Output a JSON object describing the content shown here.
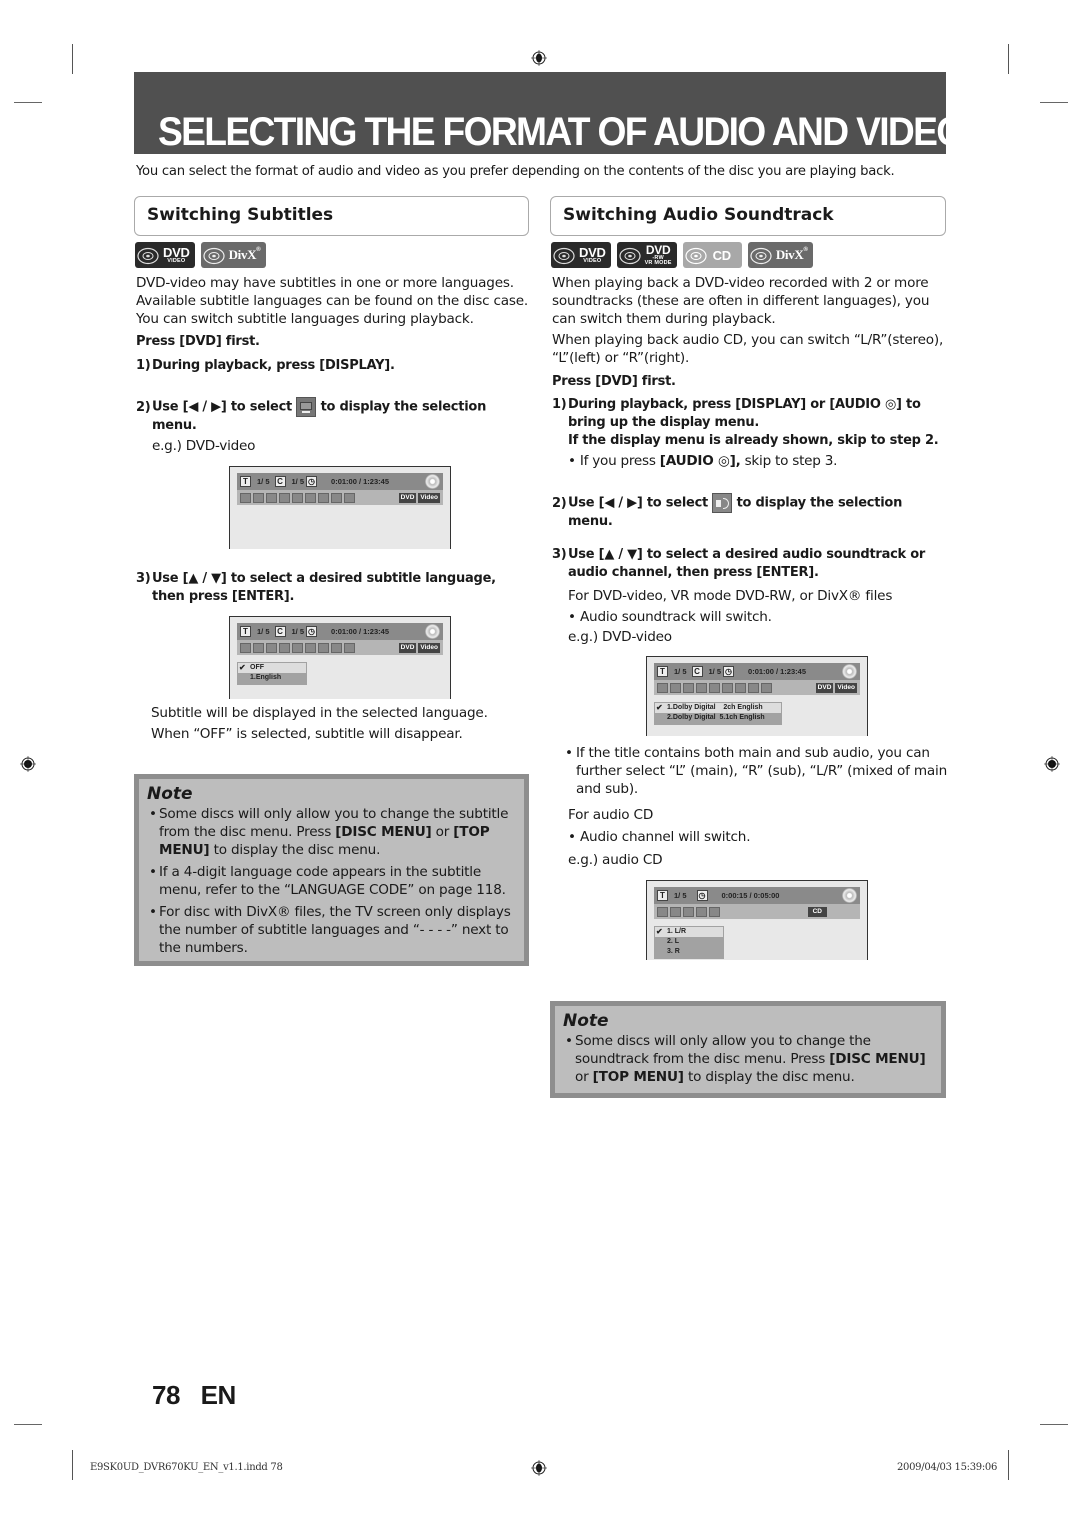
{
  "page": {
    "title": "SELECTING THE FORMAT OF AUDIO AND VIDEO",
    "intro": "You can select the format of audio and video as you prefer depending on the contents of the disc you are playing back.",
    "page_number": "78",
    "language": "EN",
    "footer_file": "E9SK0UD_DVR670KU_EN_v1.1.indd  78",
    "footer_timestamp": "2009/04/03   15:39:06"
  },
  "badges": {
    "dvd_video": {
      "main": "DVD",
      "sub": "VIDEO"
    },
    "dvd_rw_vr": {
      "main": "DVD",
      "sub1": "-RW",
      "sub2": "VR MODE"
    },
    "cd": {
      "main": "CD"
    },
    "divx": {
      "main": "DivX",
      "reg": "®"
    }
  },
  "subtitles": {
    "heading": "Switching Subtitles",
    "description": "DVD-video may have subtitles in one or more languages. Available subtitle languages can be found on the disc case. You can switch subtitle languages during playback.",
    "press_first": "Press [DVD] first.",
    "step1_num": "1)",
    "step1": "During playback, press [DISPLAY].",
    "step2_num": "2)",
    "step2_a": "Use [◀ / ▶] to select",
    "step2_b": "to display the selection",
    "step2_c": "menu.",
    "example1": "e.g.) DVD-video",
    "step3_num": "3)",
    "step3_a": "Use [▲ / ▼] to select a desired subtitle language,",
    "step3_b": "then press [ENTER].",
    "result1": "Subtitle will be displayed in the selected language.",
    "result2": "When “OFF” is selected, subtitle will disappear.",
    "osd_list": [
      "OFF",
      "1.English"
    ]
  },
  "osd_dvd": {
    "title_icon": "T",
    "title_val": "1/  5",
    "chapter_icon": "C",
    "chapter_val": "1/  5",
    "time": "0:01:00 / 1:23:45",
    "tag1": "DVD",
    "tag2": "Video"
  },
  "osd_cd": {
    "title_icon": "T",
    "title_val": "1/  5",
    "time": "0:00:15 / 0:05:00",
    "tag1": "CD"
  },
  "subtitles_note": {
    "title": "Note",
    "items": [
      {
        "a": "Some discs will only allow you to change the subtitle from the disc menu. Press ",
        "b": "[DISC MENU]",
        "c": " or ",
        "d": "[TOP MENU]",
        "e": " to display the disc menu."
      },
      {
        "text": "If a 4-digit language code appears in the subtitle menu, refer to the “LANGUAGE CODE” on page 118."
      },
      {
        "text": "For disc with DivX® files, the TV screen only displays the number of subtitle languages and “- - - -” next to the numbers."
      }
    ]
  },
  "audio": {
    "heading": "Switching Audio Soundtrack",
    "description1": "When playing back a DVD-video recorded with 2 or more soundtracks (these are often in different languages), you can switch them during playback.",
    "description2": "When playing back audio CD, you can switch “L/R”(stereo), “L”(left) or “R”(right).",
    "press_first": "Press [DVD] first.",
    "step1_num": "1)",
    "step1_a": "During playback, press [DISPLAY] or [AUDIO ◎] to bring up the display menu.",
    "step1_b": "If the display menu is already shown, skip to step 2.",
    "step1_bullet_a": "If you press ",
    "step1_bullet_b": "[AUDIO ◎],",
    "step1_bullet_c": " skip to step 3.",
    "step2_num": "2)",
    "step2_a": "Use [◀ / ▶] to select",
    "step2_b": "to display the selection",
    "step2_c": "menu.",
    "step3_num": "3)",
    "step3_a": "Use [▲ / ▼] to select a desired audio soundtrack or",
    "step3_b": "audio channel, then press [ENTER].",
    "for_dvd": "For DVD-video, VR mode DVD-RW, or DivX® files",
    "bullet_switch": "Audio soundtrack will switch.",
    "example_dvd": "e.g.) DVD-video",
    "osd_list_dvd": [
      "1.Dolby Digital    2ch English",
      "2.Dolby Digital  5.1ch English"
    ],
    "bullet_main_sub": "If the title contains both main and sub audio, you can further select “L” (main), “R” (sub), “L/R” (mixed of main and sub).",
    "for_cd": "For audio CD",
    "bullet_channel": "Audio channel will switch.",
    "example_cd": "e.g.) audio CD",
    "osd_list_cd": [
      "1. L/R",
      "2. L",
      "3. R"
    ]
  },
  "audio_note": {
    "title": "Note",
    "a": "Some discs will only allow you to change the soundtrack from the disc menu. Press ",
    "b": "[DISC MENU]",
    "c": " or ",
    "d": "[TOP MENU]",
    "e": " to display the disc menu."
  }
}
